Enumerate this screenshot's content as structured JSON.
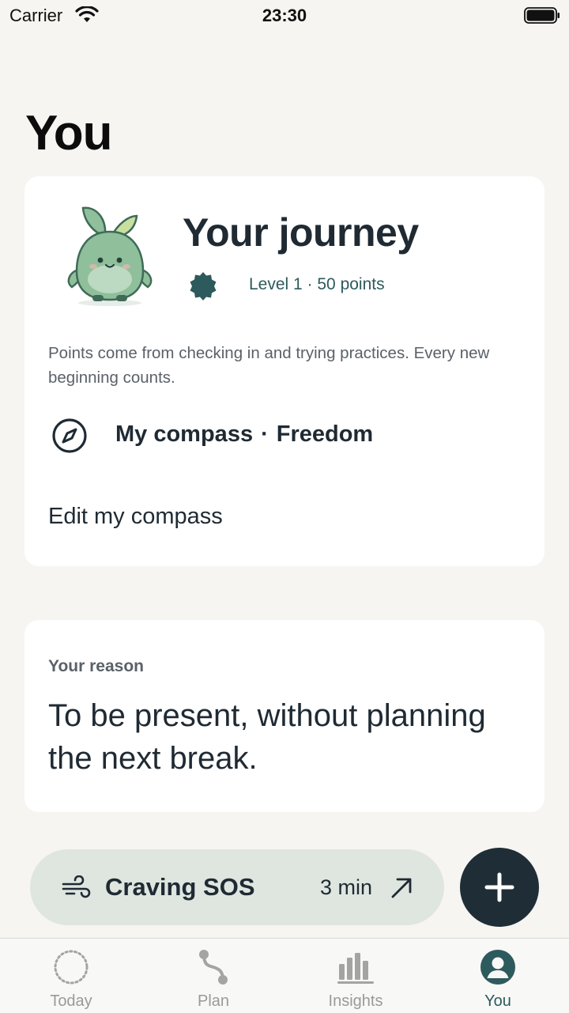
{
  "status_bar": {
    "carrier": "Carrier",
    "time": "23:30"
  },
  "page": {
    "title": "You"
  },
  "journey_card": {
    "title": "Your journey",
    "level_text": "Level 1 · 50 points",
    "points_note": "Points come from checking in and trying practices. Every new beginning counts.",
    "compass_label": "My compass",
    "compass_separator": "·",
    "compass_value": "Freedom",
    "edit_compass_label": "Edit my compass"
  },
  "reason_card": {
    "label": "Your reason",
    "text": "To be present, without planning the next break."
  },
  "sos": {
    "label": "Craving SOS",
    "duration": "3 min"
  },
  "tab_bar": {
    "items": [
      {
        "label": "Today",
        "icon": "dotted-circle-icon"
      },
      {
        "label": "Plan",
        "icon": "path-icon"
      },
      {
        "label": "Insights",
        "icon": "bar-chart-icon"
      },
      {
        "label": "You",
        "icon": "person-icon"
      }
    ],
    "active": "You"
  },
  "colors": {
    "background": "#f6f5f1",
    "card": "#ffffff",
    "accent": "#2d5a5c",
    "text_dark": "#1f2a33",
    "fab": "#1f2e36",
    "sos_pill": "#dfe6e0",
    "inactive_tab": "#9a9a9a"
  }
}
